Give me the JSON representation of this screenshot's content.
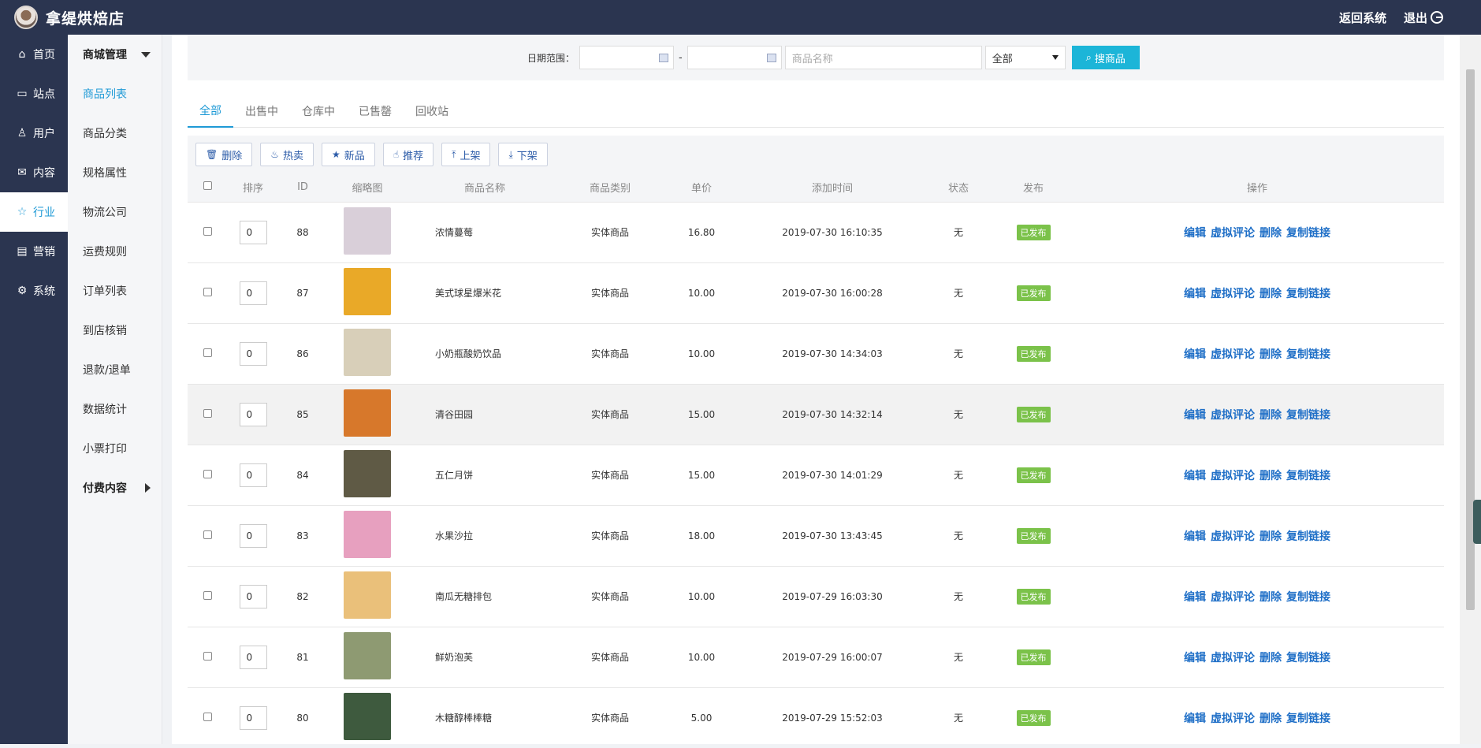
{
  "app": {
    "brand_name": "拿缇烘焙店",
    "return_label": "返回系统",
    "logout_label": "退出"
  },
  "leftnav": [
    {
      "label": "首页",
      "icon": "home-icon",
      "glyph": "⌂"
    },
    {
      "label": "站点",
      "icon": "monitor-icon",
      "glyph": "▭"
    },
    {
      "label": "用户",
      "icon": "user-icon",
      "glyph": "♙"
    },
    {
      "label": "内容",
      "icon": "inbox-icon",
      "glyph": "✉"
    },
    {
      "label": "行业",
      "icon": "star-icon",
      "glyph": "☆"
    },
    {
      "label": "营销",
      "icon": "wallet-icon",
      "glyph": "▤"
    },
    {
      "label": "系统",
      "icon": "gear-icon",
      "glyph": "⚙"
    }
  ],
  "subnav": [
    {
      "label": "商城管理"
    },
    {
      "label": "商品列表"
    },
    {
      "label": "商品分类"
    },
    {
      "label": "规格属性"
    },
    {
      "label": "物流公司"
    },
    {
      "label": "运费规则"
    },
    {
      "label": "订单列表"
    },
    {
      "label": "到店核销"
    },
    {
      "label": "退款/退单"
    },
    {
      "label": "数据统计"
    },
    {
      "label": "小票打印"
    },
    {
      "label": "付费内容"
    }
  ],
  "filter": {
    "date_label": "日期范围：",
    "dash": "-",
    "name_placeholder": "商品名称",
    "select_value": "全部",
    "search_label": "搜商品"
  },
  "tabs": [
    "全部",
    "出售中",
    "仓库中",
    "已售罄",
    "回收站"
  ],
  "toolbar": {
    "delete": "删除",
    "hot": "热卖",
    "new": "新品",
    "recommend": "推荐",
    "on_shelf": "上架",
    "off_shelf": "下架"
  },
  "table": {
    "headers": {
      "sort": "排序",
      "id": "ID",
      "thumb": "缩略图",
      "name": "商品名称",
      "category": "商品类别",
      "price": "单价",
      "time": "添加时间",
      "state": "状态",
      "publish": "发布",
      "ops": "操作"
    },
    "ops": {
      "edit": "编辑",
      "review": "虚拟评论",
      "delete": "删除",
      "copy": "复制链接"
    },
    "rows": [
      {
        "sort": "0",
        "id": "88",
        "name": "浓情蔓莓",
        "category": "实体商品",
        "price": "16.80",
        "time": "2019-07-30 16:10:35",
        "state": "无",
        "publish": "已发布",
        "thumb_color": "#d9cfd9"
      },
      {
        "sort": "0",
        "id": "87",
        "name": "美式球星爆米花",
        "category": "实体商品",
        "price": "10.00",
        "time": "2019-07-30 16:00:28",
        "state": "无",
        "publish": "已发布",
        "thumb_color": "#e9a928"
      },
      {
        "sort": "0",
        "id": "86",
        "name": "小奶瓶酸奶饮品",
        "category": "实体商品",
        "price": "10.00",
        "time": "2019-07-30 14:34:03",
        "state": "无",
        "publish": "已发布",
        "thumb_color": "#d8cfb9"
      },
      {
        "sort": "0",
        "id": "85",
        "name": "清谷田园",
        "category": "实体商品",
        "price": "15.00",
        "time": "2019-07-30 14:32:14",
        "state": "无",
        "publish": "已发布",
        "thumb_color": "#d7782b"
      },
      {
        "sort": "0",
        "id": "84",
        "name": "五仁月饼",
        "category": "实体商品",
        "price": "15.00",
        "time": "2019-07-30 14:01:29",
        "state": "无",
        "publish": "已发布",
        "thumb_color": "#5f5a45"
      },
      {
        "sort": "0",
        "id": "83",
        "name": "水果沙拉",
        "category": "实体商品",
        "price": "18.00",
        "time": "2019-07-30 13:43:45",
        "state": "无",
        "publish": "已发布",
        "thumb_color": "#e7a0bf"
      },
      {
        "sort": "0",
        "id": "82",
        "name": "南瓜无糖排包",
        "category": "实体商品",
        "price": "10.00",
        "time": "2019-07-29 16:03:30",
        "state": "无",
        "publish": "已发布",
        "thumb_color": "#eac07a"
      },
      {
        "sort": "0",
        "id": "81",
        "name": "鲜奶泡芙",
        "category": "实体商品",
        "price": "10.00",
        "time": "2019-07-29 16:00:07",
        "state": "无",
        "publish": "已发布",
        "thumb_color": "#8e9a72"
      },
      {
        "sort": "0",
        "id": "80",
        "name": "木糖醇棒棒糖",
        "category": "实体商品",
        "price": "5.00",
        "time": "2019-07-29 15:52:03",
        "state": "无",
        "publish": "已发布",
        "thumb_color": "#3e5a3e"
      }
    ]
  },
  "colors": {
    "nav_bg": "#2b3550",
    "accent": "#1f9ad6",
    "search_btn": "#1cb5d8",
    "badge": "#7bc24a",
    "link": "#1f6fc7"
  }
}
